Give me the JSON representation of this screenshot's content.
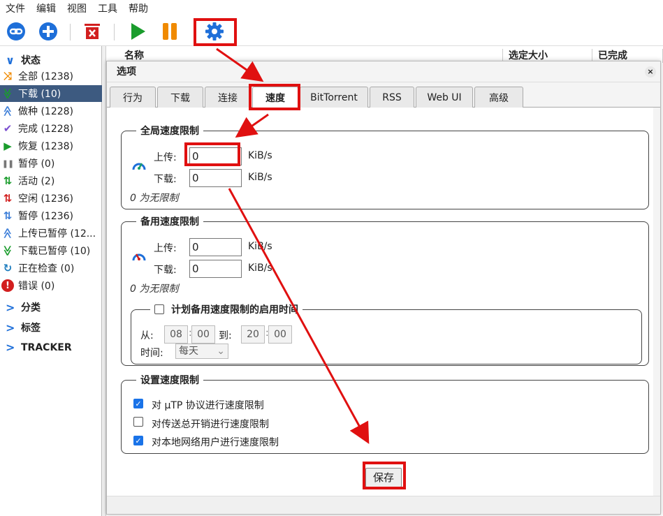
{
  "menu": [
    "文件",
    "编辑",
    "视图",
    "工具",
    "帮助"
  ],
  "toolbar": {
    "icons": [
      "link-icon",
      "add-icon",
      "delete-icon",
      "play-icon",
      "pause-icon",
      "gear-icon"
    ]
  },
  "sidebar": {
    "status_header": "状态",
    "items": [
      {
        "label": "全部 (1238)",
        "icon": "shuffle-icon",
        "color": "#f08a00"
      },
      {
        "label": "下载 (10)",
        "icon": "download-icon",
        "color": "#1a9c2c",
        "selected": true
      },
      {
        "label": "做种 (1228)",
        "icon": "upload-icon",
        "color": "#3b7dd8"
      },
      {
        "label": "完成 (1228)",
        "icon": "check-icon",
        "color": "#7b4fd0"
      },
      {
        "label": "恢复 (1238)",
        "icon": "play-icon",
        "color": "#1a9c2c"
      },
      {
        "label": "暂停 (0)",
        "icon": "pause-icon",
        "color": "#777777"
      },
      {
        "label": "活动 (2)",
        "icon": "active-icon",
        "color": "#1a9c2c"
      },
      {
        "label": "空闲 (1236)",
        "icon": "idle-icon",
        "color": "#d21f1f"
      },
      {
        "label": "暂停 (1236)",
        "icon": "stalled-icon",
        "color": "#3b7dd8"
      },
      {
        "label": "上传已暂停 (12...",
        "icon": "upload-paused-icon",
        "color": "#3b7dd8"
      },
      {
        "label": "下载已暂停 (10)",
        "icon": "download-paused-icon",
        "color": "#1a9c2c"
      },
      {
        "label": "正在检查 (0)",
        "icon": "refresh-icon",
        "color": "#1e7dbf"
      },
      {
        "label": "错误 (0)",
        "icon": "error-icon",
        "color": "#d21f1f"
      }
    ],
    "categories": "分类",
    "tags": "标签",
    "trackers": "TRACKER"
  },
  "list_header": {
    "name": "名称",
    "selected_size": "选定大小",
    "completed": "已完成"
  },
  "dialog": {
    "title": "选项",
    "close": "×",
    "tabs": [
      "行为",
      "下载",
      "连接",
      "速度",
      "BitTorrent",
      "RSS",
      "Web UI",
      "高级"
    ],
    "active_tab": "速度",
    "global": {
      "legend": "全局速度限制",
      "upload_label": "上传:",
      "upload_value": "0",
      "download_label": "下载:",
      "download_value": "0",
      "unit": "KiB/s",
      "note": "0 为无限制"
    },
    "alt": {
      "legend": "备用速度限制",
      "upload_label": "上传:",
      "upload_value": "0",
      "download_label": "下载:",
      "download_value": "0",
      "unit": "KiB/s",
      "note": "0 为无限制",
      "schedule": {
        "legend": "计划备用速度限制的启用时间",
        "checked": false,
        "from_label": "从:",
        "from_h": "08",
        "from_m": "00",
        "to_label": "到:",
        "to_h": "20",
        "to_m": "00",
        "sep": ":",
        "when_label": "时间:",
        "when_value": "每天"
      }
    },
    "rate_settings": {
      "legend": "设置速度限制",
      "opt1": "对 µTP 协议进行速度限制",
      "opt1_checked": true,
      "opt2": "对传送总开销进行速度限制",
      "opt2_checked": false,
      "opt3": "对本地网络用户进行速度限制",
      "opt3_checked": true
    },
    "save": "保存"
  },
  "annotation_color": "#e01010"
}
